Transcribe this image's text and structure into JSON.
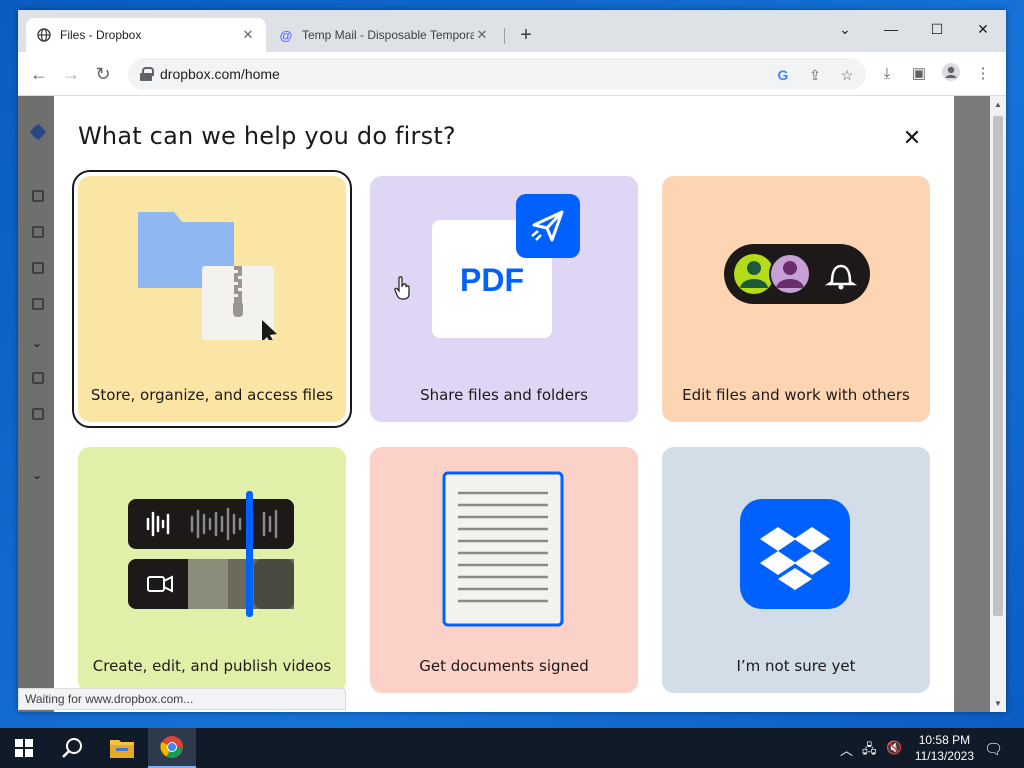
{
  "browser": {
    "tabs": [
      {
        "title": "Files - Dropbox",
        "active": true,
        "icon": "globe-icon"
      },
      {
        "title": "Temp Mail - Disposable Tempora",
        "active": false,
        "icon": "at-icon"
      }
    ],
    "new_tab_label": "+",
    "url": "dropbox.com/home",
    "status_text": "Waiting for www.dropbox.com..."
  },
  "modal": {
    "title": "What can we help you do first?",
    "close_label": "✕",
    "options": [
      {
        "label": "Store, organize, and access files",
        "selected": true
      },
      {
        "label": "Share files and folders",
        "selected": false
      },
      {
        "label": "Edit files and work with others",
        "selected": false
      },
      {
        "label": "Create, edit, and publish videos",
        "selected": false
      },
      {
        "label": "Get documents signed",
        "selected": false
      },
      {
        "label": "I’m not sure yet",
        "selected": false
      }
    ],
    "pdf_text": "PDF"
  },
  "taskbar": {
    "time": "10:58 PM",
    "date": "11/13/2023"
  },
  "colors": {
    "dropbox_blue": "#0061fe",
    "card_yellow": "#fae5a5",
    "card_lavender": "#dfd6f5",
    "card_peach": "#fdd5b2",
    "card_lime": "#e0f0a8",
    "card_pink": "#fcd1c7",
    "card_gray": "#d3dde7"
  }
}
